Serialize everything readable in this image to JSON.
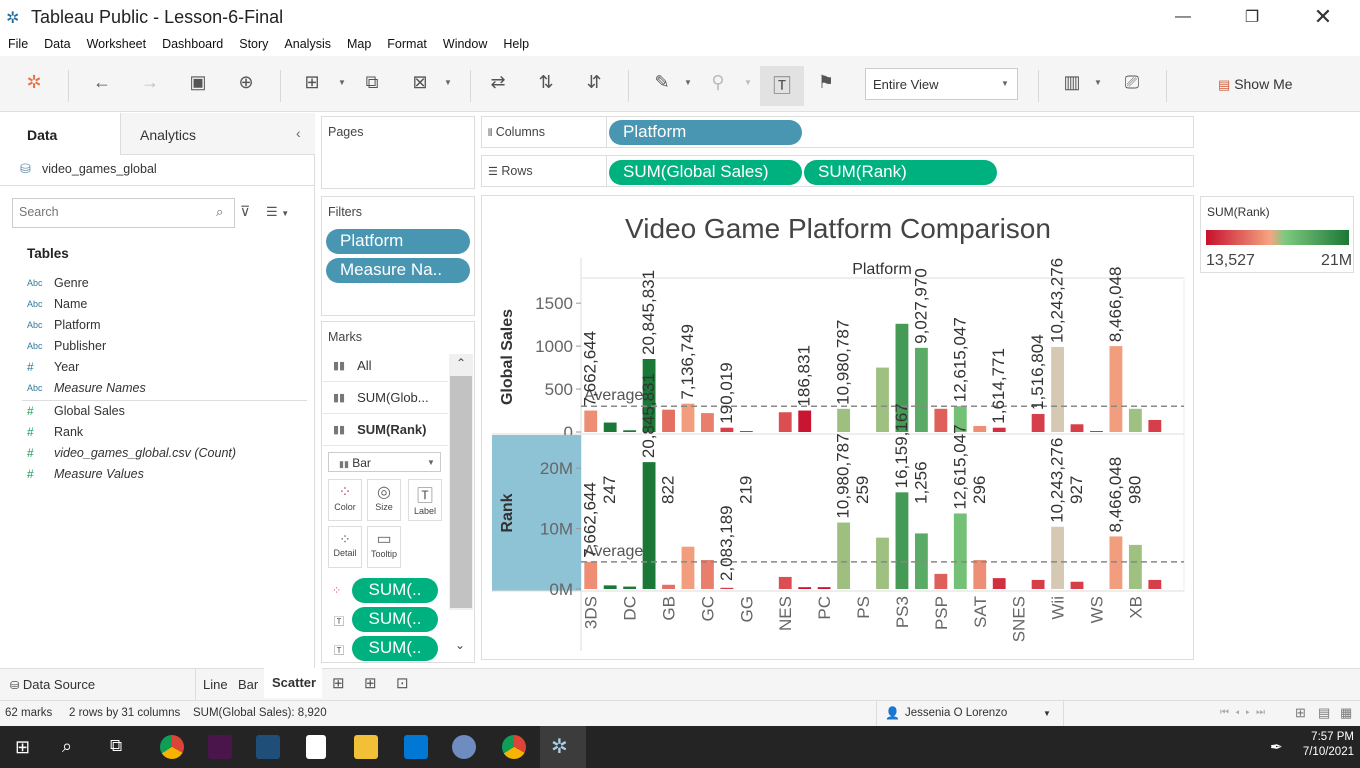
{
  "window": {
    "title": "Tableau Public - Lesson-6-Final"
  },
  "menu": [
    "File",
    "Data",
    "Worksheet",
    "Dashboard",
    "Story",
    "Analysis",
    "Map",
    "Format",
    "Window",
    "Help"
  ],
  "toolbar": {
    "fit_value": "Entire View",
    "show_me": "Show Me"
  },
  "left_pane": {
    "tab_data": "Data",
    "tab_analytics": "Analytics",
    "datasource": "video_games_global",
    "search_placeholder": "Search",
    "tables_heading": "Tables",
    "dimensions": [
      {
        "type": "Abc",
        "name": "Genre"
      },
      {
        "type": "Abc",
        "name": "Name"
      },
      {
        "type": "Abc",
        "name": "Platform"
      },
      {
        "type": "Abc",
        "name": "Publisher"
      },
      {
        "type": "#",
        "name": "Year"
      },
      {
        "type": "Abc",
        "name": "Measure Names"
      }
    ],
    "measures": [
      {
        "type": "#",
        "name": "Global Sales"
      },
      {
        "type": "#",
        "name": "Rank"
      },
      {
        "type": "#",
        "name": "video_games_global.csv (Count)"
      },
      {
        "type": "#",
        "name": "Measure Values"
      }
    ]
  },
  "cards": {
    "pages": "Pages",
    "filters": "Filters",
    "filter_pills": [
      "Platform",
      "Measure Na.."
    ],
    "marks": "Marks",
    "marks_rows": [
      "All",
      "SUM(Glob...",
      "SUM(Rank)"
    ],
    "mark_type": "Bar",
    "mark_buttons": [
      "Color",
      "Size",
      "Label",
      "Detail",
      "Tooltip"
    ],
    "mark_pills": [
      "SUM(..",
      "SUM(..",
      "SUM(.."
    ]
  },
  "shelves": {
    "columns_label": "Columns",
    "rows_label": "Rows",
    "columns_pills": [
      "Platform"
    ],
    "rows_pills": [
      "SUM(Global Sales)",
      "SUM(Rank)"
    ]
  },
  "legend": {
    "title": "SUM(Rank)",
    "min_label": "13,527",
    "max_label": "21M",
    "colors": [
      "#c8102e",
      "#f4a582",
      "#7fc97f",
      "#1b7837"
    ]
  },
  "chart_data": {
    "type": "bar",
    "title": "Video Game Platform Comparison",
    "column_header": "Platform",
    "categories": [
      "3DS",
      "",
      "DC",
      "",
      "GB",
      "",
      "GC",
      "",
      "GG",
      "",
      "NES",
      "",
      "PC",
      "",
      "PS",
      "",
      "PS3",
      "",
      "PSP",
      "",
      "SAT",
      "",
      "SNES",
      "",
      "Wii",
      "",
      "WS",
      "",
      "XB",
      "",
      ""
    ],
    "category_labels_shown": [
      "3DS",
      "DC",
      "GB",
      "GC",
      "GG",
      "NES",
      "PC",
      "PS",
      "PS3",
      "PSP",
      "SAT",
      "SNES",
      "Wii",
      "WS",
      "XB"
    ],
    "reference_line_label": "Average",
    "panes": [
      {
        "name": "Global Sales",
        "yticks": [
          "1500",
          "1000",
          "500",
          "0"
        ],
        "ytick_values": [
          1500,
          1000,
          500,
          0
        ],
        "ylim": [
          0,
          1700
        ],
        "average": 300,
        "values": [
          250,
          110,
          20,
          850,
          260,
          330,
          220,
          50,
          10,
          0,
          230,
          250,
          0,
          270,
          0,
          750,
          1260,
          980,
          270,
          300,
          70,
          50,
          0,
          210,
          990,
          90,
          10,
          1000,
          270,
          140,
          0
        ],
        "ranks": [
          8000000,
          24000000,
          20845831,
          21000000,
          6000000,
          9000000,
          7000000,
          3000000,
          100000,
          0,
          4000000,
          300000,
          0,
          10980787,
          0,
          11000000,
          17000000,
          15000000,
          5000000,
          12615047,
          8000000,
          2000000,
          0,
          3000000,
          10243276,
          3000000,
          0,
          9000000,
          11000000,
          3000000,
          0
        ],
        "labels": [
          {
            "i": 0,
            "text": "7,662,644"
          },
          {
            "i": 3,
            "text": "20,845,831"
          },
          {
            "i": 5,
            "text": "7,136,749"
          },
          {
            "i": 7,
            "text": "190,019"
          },
          {
            "i": 11,
            "text": "186,831"
          },
          {
            "i": 13,
            "text": "10,980,787"
          },
          {
            "i": 17,
            "text": "9,027,970"
          },
          {
            "i": 19,
            "text": "12,615,047"
          },
          {
            "i": 21,
            "text": "1,614,771"
          },
          {
            "i": 23,
            "text": "1,516,804"
          },
          {
            "i": 24,
            "text": "10,243,276"
          },
          {
            "i": 27,
            "text": "8,466,048"
          }
        ]
      },
      {
        "name": "Rank",
        "yticks": [
          "20M",
          "10M",
          "0M"
        ],
        "ytick_values": [
          20000000,
          10000000,
          0
        ],
        "ylim": [
          0,
          24000000
        ],
        "average": 4500000,
        "values": [
          4500000,
          600000,
          400000,
          21000000,
          700000,
          7000000,
          4800000,
          200000,
          0,
          0,
          2000000,
          300000,
          300000,
          11000000,
          0,
          8500000,
          16000000,
          9200000,
          2500000,
          12500000,
          4800000,
          1800000,
          0,
          1500000,
          10300000,
          1200000,
          0,
          8700000,
          7300000,
          1500000,
          0
        ],
        "ranks": [
          8000000,
          24000000,
          20845831,
          21000000,
          6000000,
          9000000,
          7000000,
          3000000,
          100000,
          0,
          4000000,
          300000,
          0,
          10980787,
          0,
          11000000,
          17000000,
          15000000,
          5000000,
          12615047,
          8000000,
          2000000,
          0,
          3000000,
          10243276,
          3000000,
          0,
          9000000,
          11000000,
          3000000,
          0
        ],
        "labels": [
          {
            "i": 0,
            "text": "7,662,644",
            "sub": "247"
          },
          {
            "i": 3,
            "text": "20,845,831",
            "sub": "822"
          },
          {
            "i": 7,
            "text": "2,083,189",
            "sub": "219"
          },
          {
            "i": 13,
            "text": "10,980,787",
            "sub": "259"
          },
          {
            "i": 16,
            "text": "16,159,167",
            "sub": "1,256"
          },
          {
            "i": 19,
            "text": "12,615,047",
            "sub": "296"
          },
          {
            "i": 24,
            "text": "10,243,276",
            "sub": "927"
          },
          {
            "i": 27,
            "text": "8,466,048",
            "sub": "980"
          }
        ]
      }
    ]
  },
  "sheet_tabs": {
    "data_source": "Data Source",
    "tabs": [
      "Line",
      "Bar",
      "Scatter"
    ],
    "active": "Scatter"
  },
  "status": {
    "marks": "62 marks",
    "dims": "2 rows by 31 columns",
    "sum": "SUM(Global Sales): 8,920",
    "user": "Jessenia O Lorenzo"
  },
  "taskbar": {
    "time": "7:57 PM",
    "date": "7/10/2021"
  }
}
